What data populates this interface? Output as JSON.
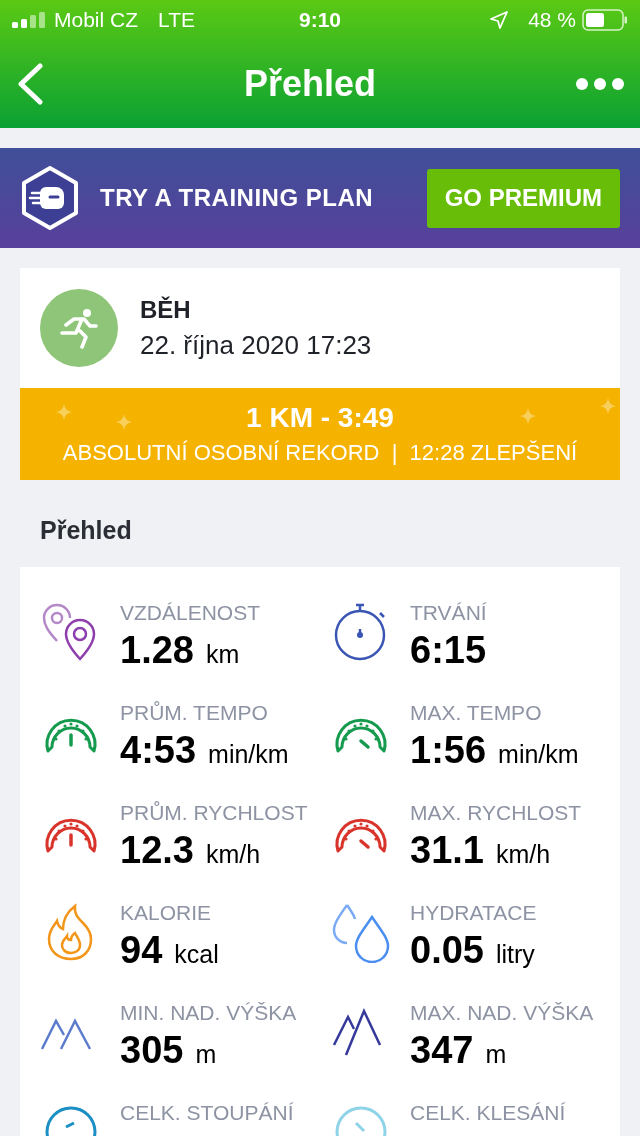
{
  "status_bar": {
    "carrier": "Mobil CZ",
    "network": "LTE",
    "time": "9:10",
    "battery": "48 %"
  },
  "nav_bar": {
    "title": "Přehled"
  },
  "promo": {
    "text": "TRY A TRAINING PLAN",
    "button": "GO PREMIUM"
  },
  "activity": {
    "sport": "BĚH",
    "date": "22. října 2020 17:23",
    "record_title": "1 KM - 3:49",
    "record_subtitle": "ABSOLUTNÍ OSOBNÍ REKORD  |  12:28 ZLEPŠENÍ"
  },
  "section_title": "Přehled",
  "stats": [
    {
      "kind": "distance",
      "color": "#8e3fae",
      "label": "VZDÁLENOST",
      "value": "1.28",
      "unit": "km"
    },
    {
      "kind": "stopwatch",
      "color": "#3b55b5",
      "label": "TRVÁNÍ",
      "value": "6:15"
    },
    {
      "kind": "gauge-avg",
      "color": "#169a4e",
      "label": "PRŮM. TEMPO",
      "value": "4:53",
      "unit": "min/km"
    },
    {
      "kind": "gauge-max",
      "color": "#169a4e",
      "label": "MAX. TEMPO",
      "value": "1:56",
      "unit": "min/km"
    },
    {
      "kind": "gauge-avg",
      "color": "#d9342b",
      "label": "PRŮM. RYCHLOST",
      "value": "12.3",
      "unit": "km/h"
    },
    {
      "kind": "gauge-max",
      "color": "#d9342b",
      "label": "MAX. RYCHLOST",
      "value": "31.1",
      "unit": "km/h"
    },
    {
      "kind": "flame",
      "color": "#f39519",
      "label": "KALORIE",
      "value": "94",
      "unit": "kcal"
    },
    {
      "kind": "drops",
      "color": "#4a8ef0",
      "label": "HYDRATACE",
      "value": "0.05",
      "unit": "litry"
    },
    {
      "kind": "mountains-low",
      "color": "#5d7ccc",
      "label": "MIN. NAD. VÝŠKA",
      "value": "305",
      "unit": "m"
    },
    {
      "kind": "mountains-high",
      "color": "#35399a",
      "label": "MAX. NAD. VÝŠKA",
      "value": "347",
      "unit": "m"
    },
    {
      "kind": "circle-ascent",
      "color": "#1b8fc4",
      "label": "CELK. STOUPÁNÍ"
    },
    {
      "kind": "circle-descent",
      "color": "#8fd3e8",
      "label": "CELK. KLESÁNÍ"
    }
  ]
}
